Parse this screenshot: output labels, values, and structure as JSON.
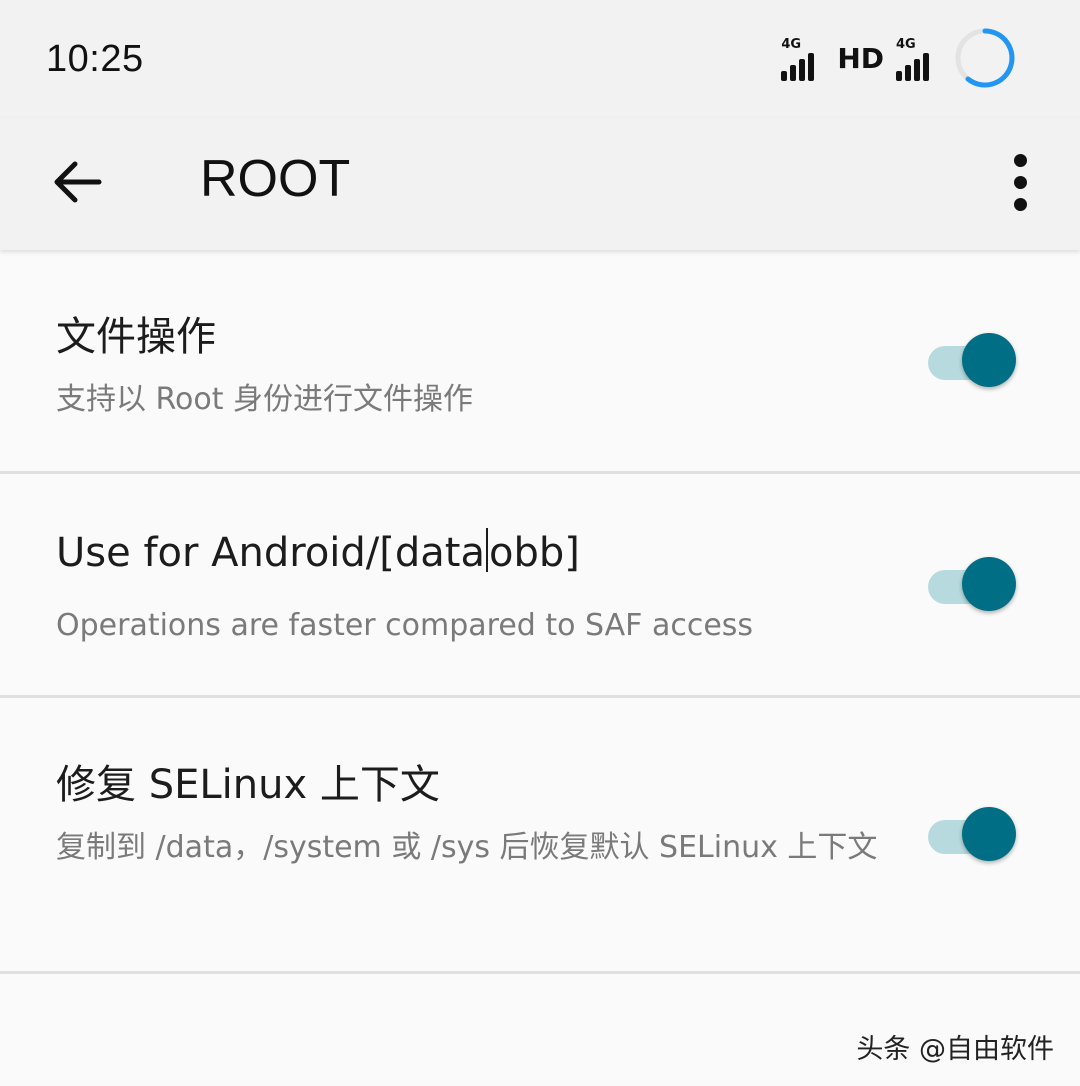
{
  "status_bar": {
    "time": "10:25",
    "signal1_label": "4G",
    "hd_label": "HD",
    "signal2_label": "4G",
    "accent": "#2196f3"
  },
  "app_bar": {
    "title": "ROOT",
    "back_icon": "arrow-back-icon",
    "menu_icon": "more-vert-icon"
  },
  "settings": [
    {
      "title": "文件操作",
      "subtitle": "支持以 Root 身份进行文件操作",
      "enabled": true
    },
    {
      "title_before_cursor": "Use for Android/[data",
      "title_after_cursor": "obb]",
      "subtitle": "Operations are faster compared to SAF access",
      "enabled": true
    },
    {
      "title": "修复 SELinux 上下文",
      "subtitle": "复制到 /data，/system 或 /sys 后恢复默认 SELinux 上下文",
      "enabled": true
    }
  ],
  "colors": {
    "switch_thumb": "#006f86",
    "switch_track": "#b7dadf"
  },
  "watermark": "头条 @自由软件"
}
